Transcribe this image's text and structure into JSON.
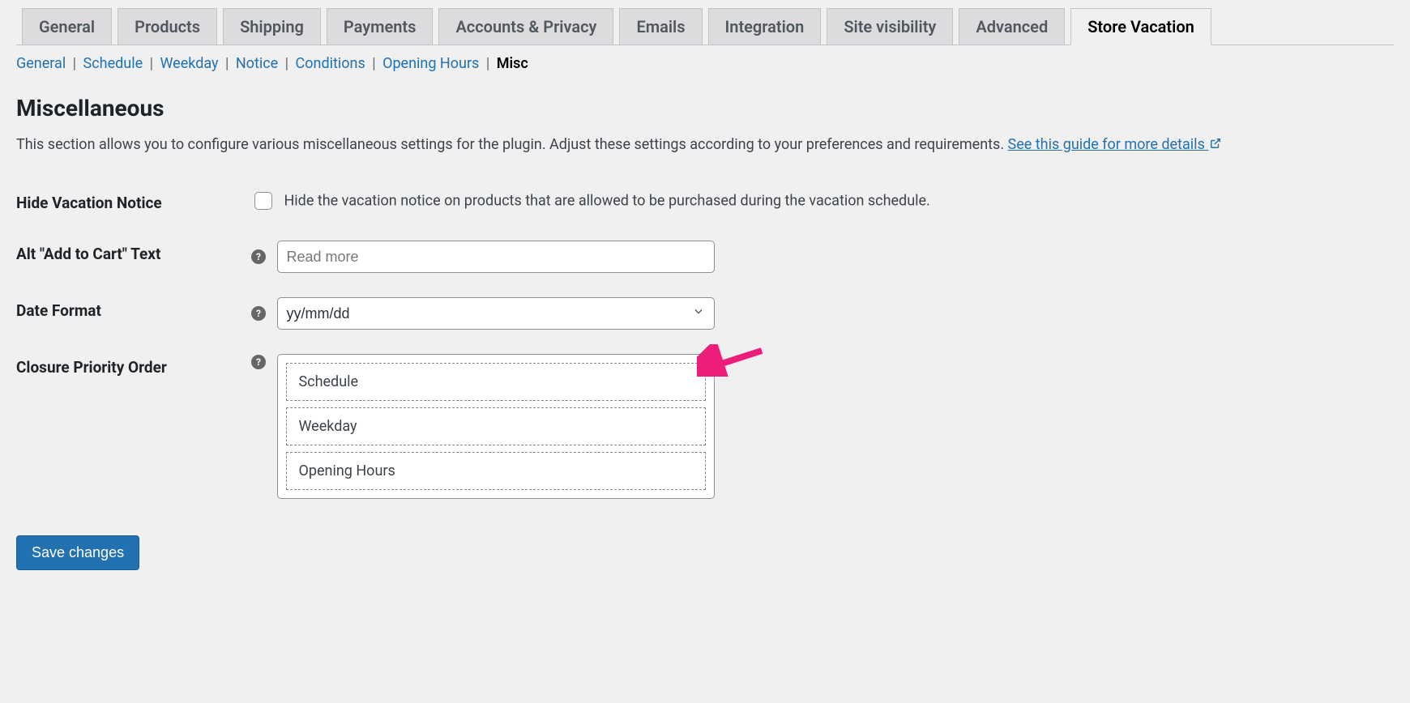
{
  "tabs": {
    "main": [
      {
        "label": "General",
        "active": false
      },
      {
        "label": "Products",
        "active": false
      },
      {
        "label": "Shipping",
        "active": false
      },
      {
        "label": "Payments",
        "active": false
      },
      {
        "label": "Accounts & Privacy",
        "active": false
      },
      {
        "label": "Emails",
        "active": false
      },
      {
        "label": "Integration",
        "active": false
      },
      {
        "label": "Site visibility",
        "active": false
      },
      {
        "label": "Advanced",
        "active": false
      },
      {
        "label": "Store Vacation",
        "active": true
      }
    ],
    "sub": [
      {
        "label": "General",
        "active": false
      },
      {
        "label": "Schedule",
        "active": false
      },
      {
        "label": "Weekday",
        "active": false
      },
      {
        "label": "Notice",
        "active": false
      },
      {
        "label": "Conditions",
        "active": false
      },
      {
        "label": "Opening Hours",
        "active": false
      },
      {
        "label": "Misc",
        "active": true
      }
    ]
  },
  "section": {
    "title": "Miscellaneous",
    "description": "This section allows you to configure various miscellaneous settings for the plugin. Adjust these settings according to your preferences and requirements. ",
    "guide_link_text": "See this guide for more details"
  },
  "fields": {
    "hide_notice": {
      "label": "Hide Vacation Notice",
      "description": "Hide the vacation notice on products that are allowed to be purchased during the vacation schedule.",
      "checked": false
    },
    "alt_add_to_cart": {
      "label": "Alt \"Add to Cart\" Text",
      "placeholder": "Read more",
      "value": ""
    },
    "date_format": {
      "label": "Date Format",
      "value": "yy/mm/dd"
    },
    "closure_priority": {
      "label": "Closure Priority Order",
      "items": [
        "Schedule",
        "Weekday",
        "Opening Hours"
      ]
    }
  },
  "buttons": {
    "save": "Save changes"
  },
  "tooltip_glyph": "?"
}
